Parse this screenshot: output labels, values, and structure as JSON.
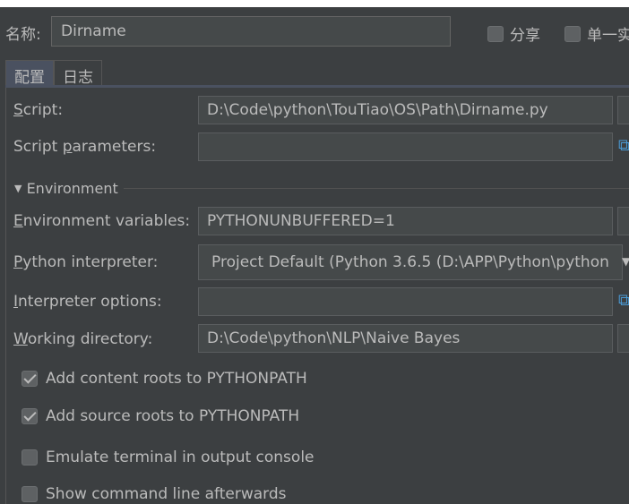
{
  "header": {
    "name_label": "名称:",
    "name_value": "Dirname",
    "share_label": "分享",
    "share_checked": false,
    "single_instance_label": "单一实",
    "single_instance_checked": false
  },
  "tabs": [
    {
      "label": "配置",
      "active": true
    },
    {
      "label": "日志",
      "active": false
    }
  ],
  "form": {
    "script": {
      "mnemonic": "S",
      "rest": "cript:",
      "value": "D:\\Code\\python\\TouTiao\\OS\\Path\\Dirname.py"
    },
    "script_parameters": {
      "before": "Script ",
      "mnemonic": "p",
      "after": "arameters:",
      "value": ""
    },
    "environment_section": "Environment",
    "environment_variables": {
      "mnemonic": "E",
      "rest": "nvironment variables:",
      "value": "PYTHONUNBUFFERED=1"
    },
    "python_interpreter": {
      "mnemonic": "P",
      "rest": "ython interpreter:",
      "value": "Project Default (Python 3.6.5 (D:\\APP\\Python\\python"
    },
    "interpreter_options": {
      "mnemonic": "I",
      "rest": "nterpreter options:",
      "value": ""
    },
    "working_directory": {
      "mnemonic": "W",
      "rest": "orking directory:",
      "value": "D:\\Code\\python\\NLP\\Naive Bayes"
    }
  },
  "options": [
    {
      "label": "Add content roots to PYTHONPATH",
      "checked": true
    },
    {
      "label": "Add source roots to PYTHONPATH",
      "checked": true
    },
    {
      "label": "Emulate terminal in output console",
      "checked": false
    },
    {
      "label": "Show command line afterwards",
      "checked": false
    }
  ],
  "colors": {
    "background": "#3c3f41",
    "field": "#45494a",
    "text": "#bbbbbb",
    "accent": "#4a9bd6"
  }
}
